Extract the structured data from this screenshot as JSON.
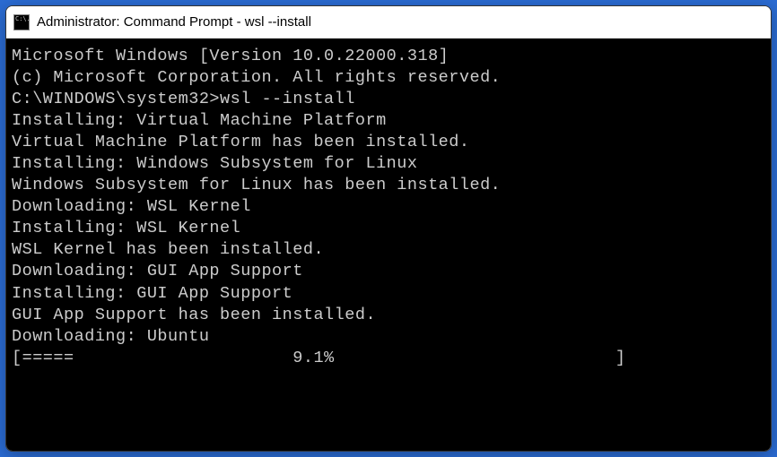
{
  "window": {
    "icon_text": "C:\\.",
    "title": "Administrator: Command Prompt - wsl  --install"
  },
  "console": {
    "lines": [
      "Microsoft Windows [Version 10.0.22000.318]",
      "(c) Microsoft Corporation. All rights reserved.",
      "",
      "C:\\WINDOWS\\system32>wsl --install",
      "Installing: Virtual Machine Platform",
      "Virtual Machine Platform has been installed.",
      "Installing: Windows Subsystem for Linux",
      "Windows Subsystem for Linux has been installed.",
      "Downloading: WSL Kernel",
      "Installing: WSL Kernel",
      "WSL Kernel has been installed.",
      "Downloading: GUI App Support",
      "Installing: GUI App Support",
      "GUI App Support has been installed.",
      "Downloading: Ubuntu",
      "[=====                     9.1%                           ]"
    ]
  }
}
